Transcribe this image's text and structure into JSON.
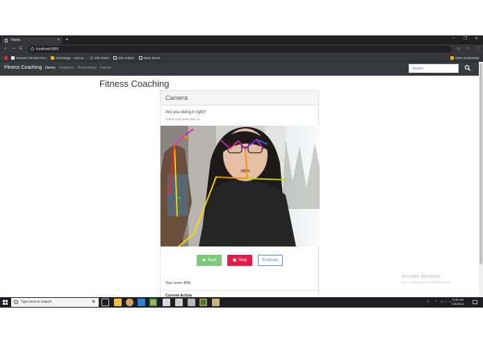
{
  "browser": {
    "tab_title": "Home",
    "tab_close": "×",
    "new_tab": "+",
    "window_controls": [
      "–",
      "❐",
      "✕"
    ],
    "nav_buttons": [
      "←",
      "→",
      "C"
    ],
    "url": "localhost:5000",
    "right_icons": [
      "☆",
      "⌂",
      "⋮"
    ],
    "bookmarks": [
      {
        "label": "Stewart Calculus Ess...",
        "color": "#d93025"
      },
      {
        "label": "Homepage - myCou...",
        "color": "#f4b400"
      },
      {
        "label": "208 Slides",
        "color": "#5f6368"
      },
      {
        "label": "206 Outline",
        "color": "#e8eaed"
      },
      {
        "label": "Bash Sheet",
        "color": "#e8eaed"
      }
    ],
    "other_bookmarks": "Other bookmarks"
  },
  "site": {
    "brand": "Fitness Coaching",
    "nav": [
      {
        "label": "Demo",
        "active": true
      },
      {
        "label": "Features",
        "active": false
      },
      {
        "label": "Technology",
        "active": false
      },
      {
        "label": "Future",
        "active": false
      }
    ],
    "search_placeholder": "Search"
  },
  "main": {
    "title": "Fitness Coaching",
    "card_title": "Camera",
    "question": "Are you doing it right?",
    "subtitle": "Check your pose with us",
    "buttons": {
      "start": "Start",
      "stop": "Stop",
      "evaluate": "Evaluate"
    },
    "score": "Your score: 89%",
    "current_action": "Current Action"
  },
  "watermark": {
    "line1": "Activate Windows",
    "line2": "Go to Settings to activate Windows."
  },
  "taskbar": {
    "search_placeholder": "Type here to search",
    "apps": [
      "task-view",
      "file-explorer",
      "chrome",
      "vscode",
      "security",
      "notes",
      "photos",
      "settings",
      "terminal",
      "game"
    ],
    "tray_icons": [
      "⚐",
      "^",
      "▭",
      "♪",
      "⌁"
    ],
    "time": "10:50 AM",
    "date": "9/30/2018"
  },
  "colors": {
    "navbar": "#343a40",
    "start": "#7dc97a",
    "stop": "#e5194b",
    "evaluate": "#4a8fd4",
    "skeleton_colors": [
      "#ff8c00",
      "#ffe000",
      "#7cdb2a",
      "#c81ec8",
      "#2a6bff",
      "#ff2aa0"
    ]
  }
}
